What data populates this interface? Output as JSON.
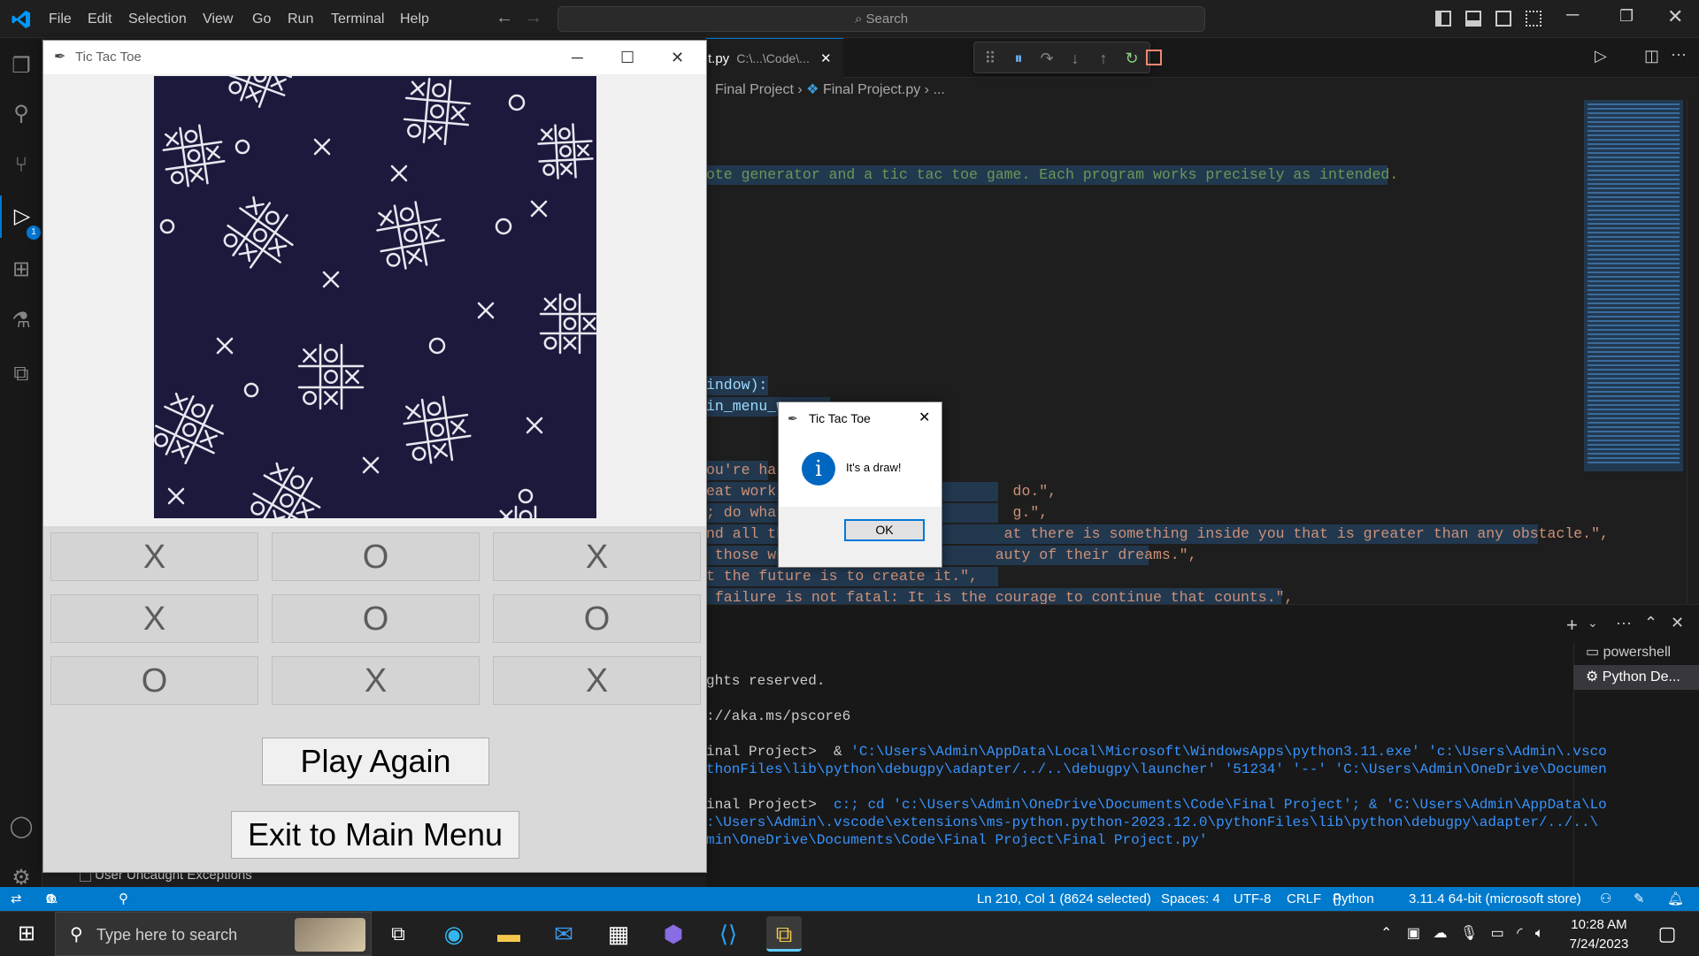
{
  "vscode": {
    "menu": [
      "File",
      "Edit",
      "Selection",
      "View",
      "Go",
      "Run",
      "Terminal",
      "Help"
    ],
    "search_placeholder": "Search",
    "activity_badge": "1",
    "tab": {
      "label": "t.py",
      "path": "C:\\...\\Code\\..."
    },
    "breadcrumb": {
      "folder": "Final Project",
      "file": "Final Project.py",
      "more": "..."
    },
    "code_lines": [
      {
        "text": "ote generator and a tic tac toe game. Each program works precisely as intended.",
        "color": "#6a9955"
      },
      {
        "text": "indow):",
        "color": "#9cdcfe"
      },
      {
        "text": "in_menu_w",
        "color": "#9cdcfe"
      },
      {
        "text": "ou're hal",
        "color": "#ce9178"
      },
      {
        "text": "eat work                           do.\",",
        "color": "#ce9178"
      },
      {
        "text": "; do what                          g.\",",
        "color": "#ce9178"
      },
      {
        "text": "nd all th                         at there is something inside you that is greater than any obstacle.\",",
        "color": "#ce9178"
      },
      {
        "text": " those wh                        auty of their dreams.\",",
        "color": "#ce9178"
      },
      {
        "text": "t the future is to create it.\",",
        "color": "#ce9178"
      },
      {
        "text": " failure is not fatal: It is the courage to continue that counts.\",",
        "color": "#ce9178"
      }
    ],
    "terminal_lines": [
      {
        "text": "ghts reserved.",
        "color": "#cccccc"
      },
      {
        "text": "://aka.ms/pscore6",
        "color": "#cccccc"
      },
      {
        "prefix": "inal Project>  & ",
        "text": "'C:\\Users\\Admin\\AppData\\Local\\Microsoft\\WindowsApps\\python3.11.exe' 'c:\\Users\\Admin\\.vsco",
        "color": "#3794ff"
      },
      {
        "prefix": "",
        "text": "thonFiles\\lib\\python\\debugpy\\adapter/../..\\debugpy\\launcher' '51234' '--' 'C:\\Users\\Admin\\OneDrive\\Documen",
        "color": "#3794ff"
      },
      {
        "prefix": "inal Project>  ",
        "text": "c:; cd 'c:\\Users\\Admin\\OneDrive\\Documents\\Code\\Final Project'; & 'C:\\Users\\Admin\\AppData\\Lo",
        "color": "#3794ff"
      },
      {
        "prefix": "",
        "text": ":\\Users\\Admin\\.vscode\\extensions\\ms-python.python-2023.12.0\\pythonFiles\\lib\\python\\debugpy\\adapter/../..\\",
        "color": "#3794ff"
      },
      {
        "prefix": "",
        "text": "min\\OneDrive\\Documents\\Code\\Final Project\\Final Project.py'",
        "color": "#3794ff"
      }
    ],
    "terminals": [
      "powershell",
      "Python De..."
    ],
    "breakpoint_label": "User Uncaught Exceptions",
    "status": {
      "errors": "0",
      "warnings": "0",
      "position": "Ln 210, Col 1 (8624 selected)",
      "spaces": "Spaces: 4",
      "encoding": "UTF-8",
      "eol": "CRLF",
      "language": "Python",
      "interpreter": "3.11.4 64-bit (microsoft store)"
    }
  },
  "game_window": {
    "title": "Tic Tac Toe",
    "board": [
      [
        "X",
        "O",
        "X"
      ],
      [
        "X",
        "O",
        "O"
      ],
      [
        "O",
        "X",
        "X"
      ]
    ],
    "play_again": "Play Again",
    "exit_menu": "Exit to Main Menu"
  },
  "dialog": {
    "title": "Tic Tac Toe",
    "message": "It's a draw!",
    "ok": "OK"
  },
  "taskbar": {
    "search_placeholder": "Type here to search",
    "time": "10:28 AM",
    "date": "7/24/2023"
  },
  "colors": {
    "accent": "#007acc",
    "board_background": "#1b1a3d",
    "info_icon": "#0067c0"
  }
}
